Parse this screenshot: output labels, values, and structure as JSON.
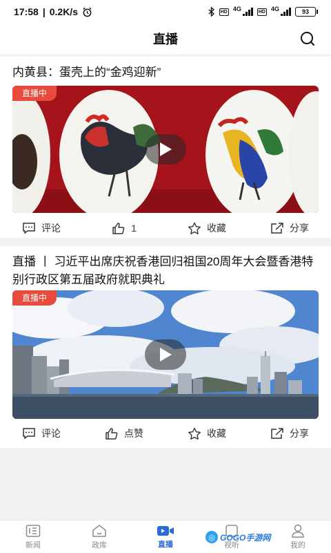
{
  "status_bar": {
    "time": "17:58",
    "speed": "0.2K/s",
    "net1": "4G",
    "net2": "4G",
    "hd": "HD",
    "battery": "93"
  },
  "header": {
    "title": "直播"
  },
  "feed": [
    {
      "title": "内黄县：蛋壳上的“金鸡迎新”",
      "badge": "直播中",
      "actions": {
        "comment": "评论",
        "like": "1",
        "favorite": "收藏",
        "share": "分享"
      }
    },
    {
      "title": "直播 丨 习近平出席庆祝香港回归祖国20周年大会暨香港特别行政区第五届政府就职典礼",
      "badge": "直播中",
      "actions": {
        "comment": "评论",
        "like": "点赞",
        "favorite": "收藏",
        "share": "分享"
      }
    }
  ],
  "bottom_nav": [
    {
      "label": "新闻",
      "icon": "news-icon",
      "active": false
    },
    {
      "label": "政库",
      "icon": "home-icon",
      "active": false
    },
    {
      "label": "直播",
      "icon": "live-video-icon",
      "active": true
    },
    {
      "label": "视听",
      "icon": "media-icon",
      "active": false
    },
    {
      "label": "我的",
      "icon": "user-icon",
      "active": false
    }
  ],
  "watermark": {
    "text": "GOGO手游网"
  },
  "colors": {
    "accent": "#2a6bd8",
    "live_badge": "#e84a3c",
    "watermark": "#2a7be0"
  }
}
